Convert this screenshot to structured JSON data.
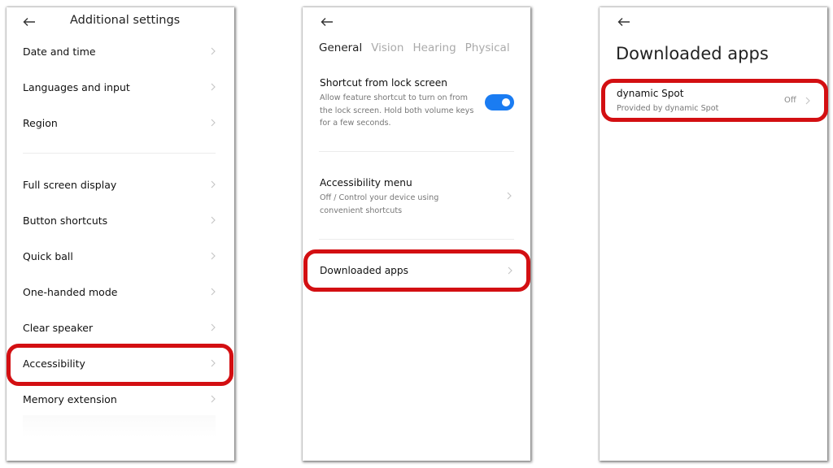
{
  "screens": [
    {
      "title": "Additional settings",
      "back_icon": "arrow-left-icon",
      "group1": [
        {
          "label": "Date and time"
        },
        {
          "label": "Languages and input"
        },
        {
          "label": "Region"
        }
      ],
      "group2": [
        {
          "label": "Full screen display"
        },
        {
          "label": "Button shortcuts"
        },
        {
          "label": "Quick ball"
        },
        {
          "label": "One-handed mode"
        },
        {
          "label": "Clear speaker"
        },
        {
          "label": "Accessibility",
          "highlighted": true
        },
        {
          "label": "Memory extension"
        }
      ]
    },
    {
      "back_icon": "arrow-left-icon",
      "tabs": [
        {
          "label": "General",
          "active": true
        },
        {
          "label": "Vision",
          "active": false
        },
        {
          "label": "Hearing",
          "active": false
        },
        {
          "label": "Physical",
          "active": false
        }
      ],
      "shortcut": {
        "title": "Shortcut from lock screen",
        "description": "Allow feature shortcut to turn on from the lock screen. Hold both volume keys for a few seconds.",
        "enabled": true
      },
      "accessibility_menu": {
        "title": "Accessibility menu",
        "description": "Off / Control your device using convenient shortcuts"
      },
      "downloaded_apps": {
        "label": "Downloaded apps",
        "highlighted": true
      }
    },
    {
      "back_icon": "arrow-left-icon",
      "title": "Downloaded apps",
      "apps": [
        {
          "name": "dynamic Spot",
          "provider": "Provided by dynamic Spot",
          "status": "Off",
          "highlighted": true
        }
      ]
    }
  ],
  "colors": {
    "highlight": "#d30f12",
    "toggle_on": "#1a7cf2"
  }
}
